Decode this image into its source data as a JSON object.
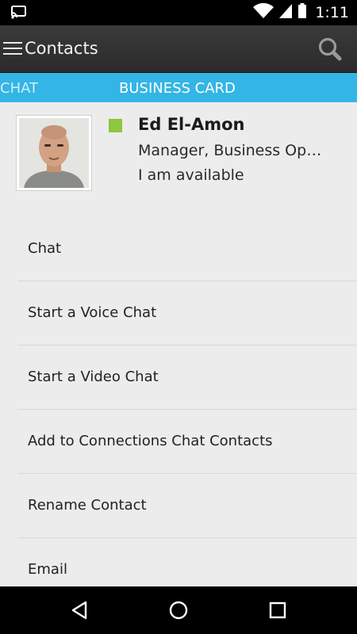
{
  "status_bar": {
    "time": "1:11",
    "icons": [
      "cast-icon",
      "wifi-icon",
      "signal-icon",
      "battery-icon"
    ]
  },
  "action_bar": {
    "title": "Contacts",
    "icons": [
      "menu-icon",
      "search-icon"
    ]
  },
  "tabs": [
    {
      "label": "CHAT",
      "selected": false
    },
    {
      "label": "BUSINESS CARD",
      "selected": true
    }
  ],
  "contact": {
    "name": "Ed El-Amon",
    "title": "Manager, Business Op…",
    "status": "I am available",
    "presence_color": "#8dc63f"
  },
  "actions": [
    {
      "label": "Chat"
    },
    {
      "label": "Start a Voice Chat"
    },
    {
      "label": "Start a Video Chat"
    },
    {
      "label": "Add to Connections Chat Contacts"
    },
    {
      "label": "Rename Contact"
    },
    {
      "label": "Email"
    }
  ],
  "nav_bar": {
    "icons": [
      "back-icon",
      "home-icon",
      "recent-apps-icon"
    ]
  },
  "colors": {
    "accent": "#33b5e5",
    "action_bar": "#2f2f2f",
    "background": "#ececec"
  }
}
